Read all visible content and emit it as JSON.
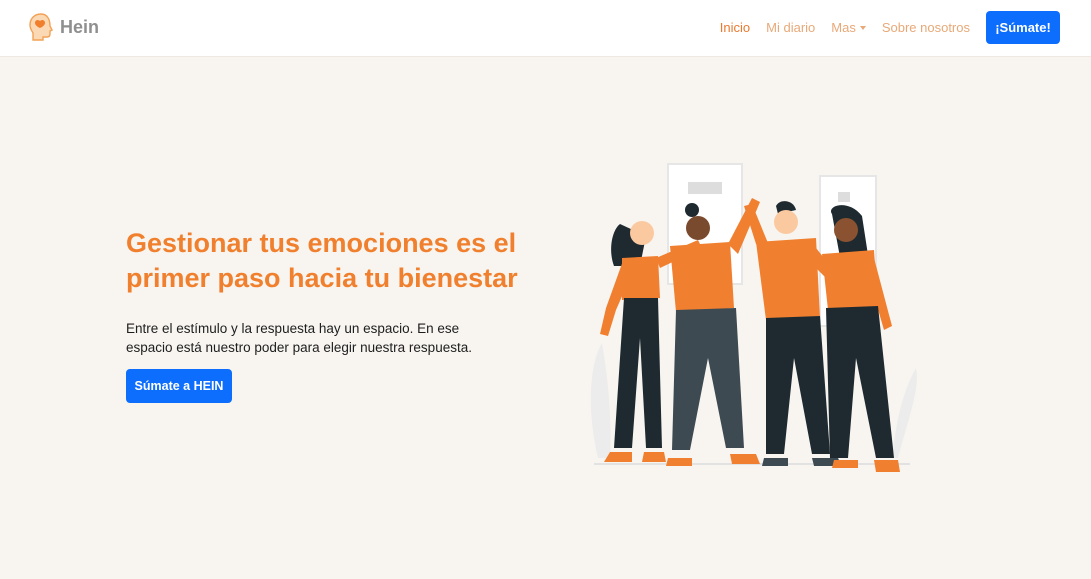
{
  "brand": {
    "name": "Hein",
    "logo_icon": "head-heart-icon"
  },
  "nav": {
    "links": [
      {
        "label": "Inicio",
        "active": true
      },
      {
        "label": "Mi diario",
        "active": false
      },
      {
        "label": "Mas",
        "active": false,
        "dropdown": true
      },
      {
        "label": "Sobre nosotros",
        "active": false
      }
    ],
    "cta_label": "¡Súmate!"
  },
  "hero": {
    "title": "Gestionar tus emociones es el primer paso hacia tu bienestar",
    "text": "Entre el estímulo y la respuesta hay un espacio. En ese espacio está nuestro poder para elegir nuestra respuesta.",
    "cta_label": "Súmate a HEIN"
  },
  "colors": {
    "accent": "#f0802d",
    "nav_link": "#e8a978",
    "primary_button": "#0d6efd",
    "page_background": "#f8f5f1"
  }
}
